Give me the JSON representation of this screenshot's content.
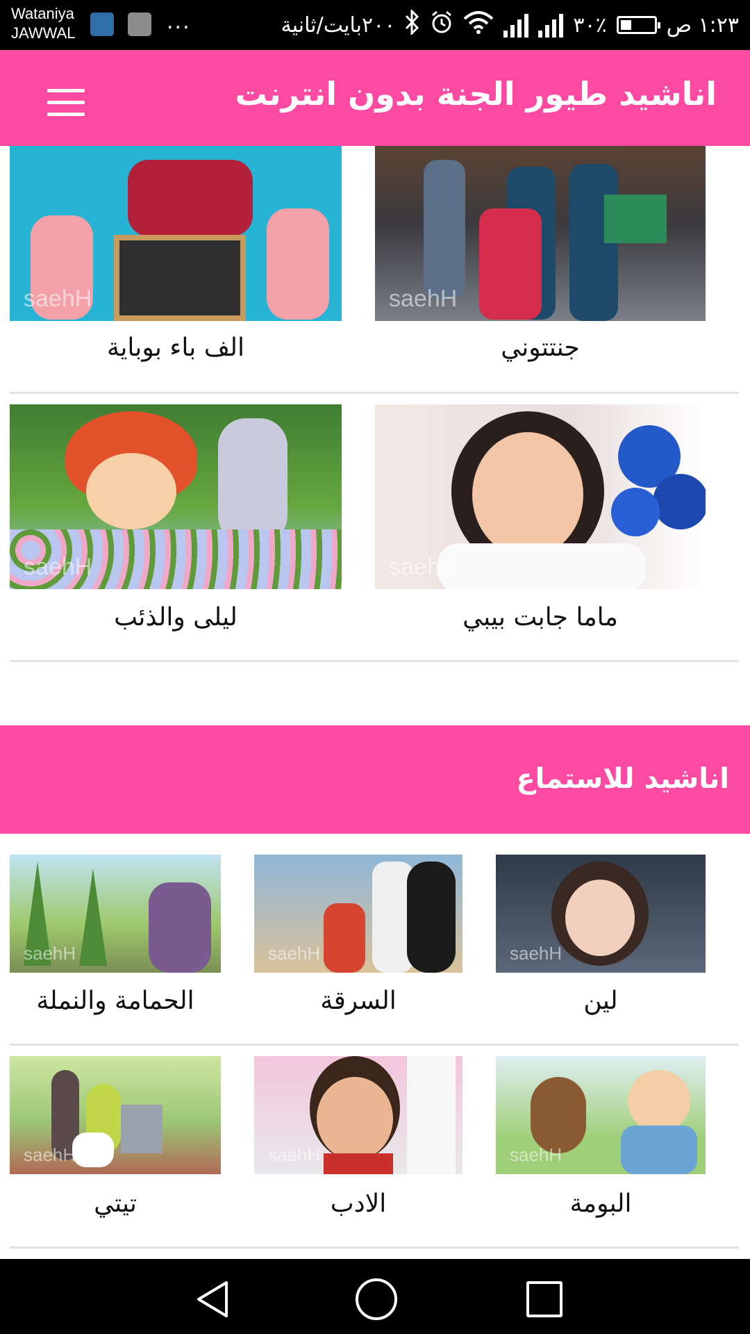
{
  "status_bar": {
    "carrier_line1": "Wataniya",
    "carrier_line2": "JAWWAL",
    "time": "١:٢٣ ص",
    "battery": "٣٠٪",
    "speed": "٢٠٠بايت/ثانية",
    "dots": "..."
  },
  "app_bar": {
    "title": "اناشيد طيور الجنة بدون انترنت"
  },
  "video_grid": [
    {
      "title": "جنتتوني"
    },
    {
      "title": "الف باء بوباية"
    },
    {
      "title": "ماما جابت بيبي"
    },
    {
      "title": "ليلى والذئب"
    }
  ],
  "listen_section": {
    "title": "اناشيد للاستماع",
    "items": [
      {
        "title": "لين"
      },
      {
        "title": "السرقة"
      },
      {
        "title": "الحمامة والنملة"
      },
      {
        "title": "البومة"
      },
      {
        "title": "الادب"
      },
      {
        "title": "تيتي"
      }
    ]
  },
  "colors": {
    "accent": "#fc4aa2",
    "status_bar": "#000000",
    "divider": "#e2e2e2"
  },
  "icons": {
    "menu": "hamburger-menu-icon",
    "back": "back-triangle-icon",
    "home": "home-circle-icon",
    "recent": "recent-square-icon"
  }
}
